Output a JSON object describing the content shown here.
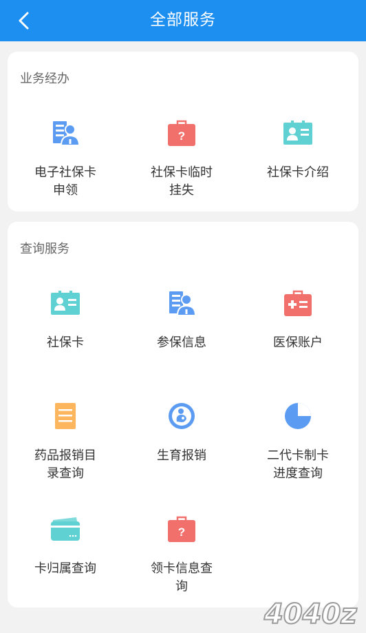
{
  "header": {
    "title": "全部服务"
  },
  "sections": [
    {
      "title": "业务经办",
      "items": [
        {
          "label": "电子社保卡\n申领",
          "icon": "id-card-person-icon"
        },
        {
          "label": "社保卡临时\n挂失",
          "icon": "question-briefcase-icon"
        },
        {
          "label": "社保卡介绍",
          "icon": "contact-card-icon"
        }
      ]
    },
    {
      "title": "查询服务",
      "items": [
        {
          "label": "社保卡",
          "icon": "contact-card-icon"
        },
        {
          "label": "参保信息",
          "icon": "id-card-person-icon"
        },
        {
          "label": "医保账户",
          "icon": "medical-kit-icon"
        },
        {
          "label": "药品报销目\n录查询",
          "icon": "document-list-icon"
        },
        {
          "label": "生育报销",
          "icon": "baby-circle-icon"
        },
        {
          "label": "二代卡制卡\n进度查询",
          "icon": "progress-pie-icon"
        },
        {
          "label": "卡归属查询",
          "icon": "credit-card-icon"
        },
        {
          "label": "领卡信息查\n询",
          "icon": "question-briefcase-icon"
        }
      ]
    }
  ],
  "watermark": {
    "text": "4040z"
  },
  "colors": {
    "header": "#1d8ff1",
    "blue_icon": "#5b9cf2",
    "red_icon": "#f2706b",
    "teal_icon": "#5fd1d3",
    "orange_icon": "#fdb65e"
  }
}
